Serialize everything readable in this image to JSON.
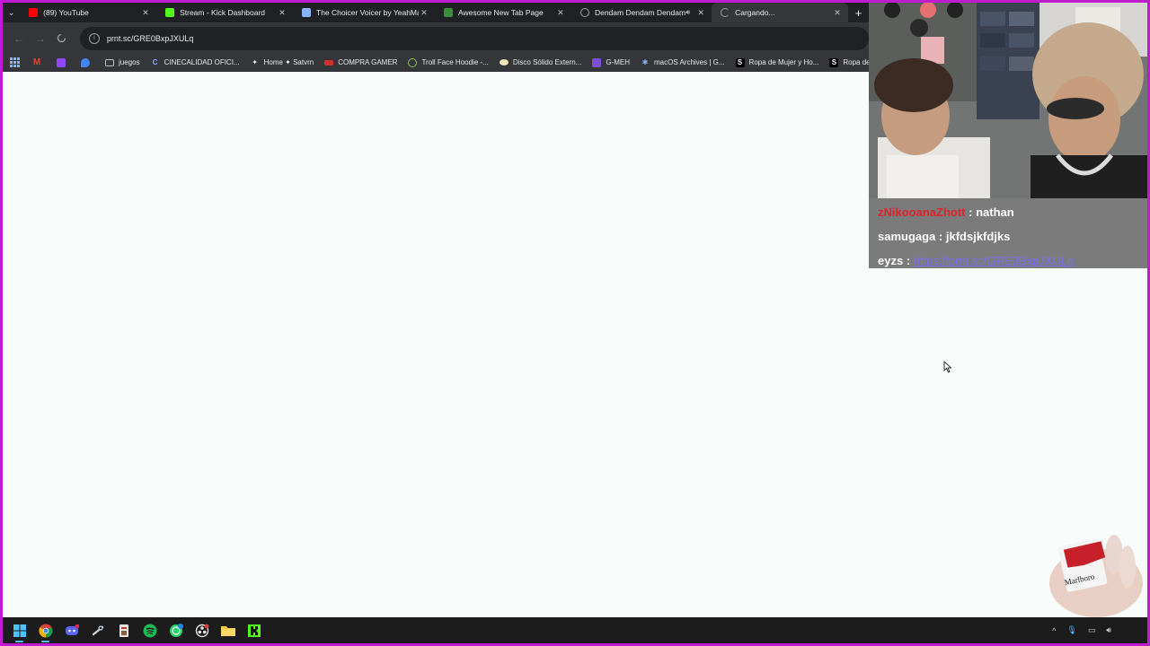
{
  "browser": {
    "tabs": [
      {
        "title": "(89) YouTube",
        "favicon_color": "#ff0000"
      },
      {
        "title": "Stream - Kick Dashboard",
        "favicon_color": "#53fc18"
      },
      {
        "title": "The Choicer Voicer by YeahMay",
        "favicon_color": "#8ab4f8"
      },
      {
        "title": "Awesome New Tab Page",
        "favicon_color": "#3c8d3c"
      },
      {
        "title": "Dendam Dendam Dendam",
        "favicon_color": "#9aa0a6"
      },
      {
        "title": "Cargando...",
        "favicon_color": "#9aa0a6"
      }
    ],
    "address": {
      "url": "prnt.sc/GRE0BxpJXULq"
    },
    "bookmarks": [
      {
        "label": "juegos",
        "icon": "folder-icon"
      },
      {
        "label": "CINECALIDAD OFICI...",
        "icon": "c-icon"
      },
      {
        "label": "Home ✦ Satvrn",
        "icon": "star-icon"
      },
      {
        "label": "COMPRA GAMER",
        "icon": "compra-icon"
      },
      {
        "label": "Troll Face Hoodie -...",
        "icon": "troll-icon"
      },
      {
        "label": "Disco Sólido Extern...",
        "icon": "disk-icon"
      },
      {
        "label": "G-MEH",
        "icon": "g-icon"
      },
      {
        "label": "macOS Archives | G...",
        "icon": "mac-icon"
      },
      {
        "label": "Ropa de Mujer y Ho...",
        "icon": "s-icon"
      },
      {
        "label": "Ropa de Mujer y H",
        "icon": "s-icon"
      }
    ]
  },
  "chat": {
    "messages": [
      {
        "user": "zNikooanaZhott",
        "sep": " : ",
        "text": "nathan"
      },
      {
        "user": "samugaga",
        "sep": " : ",
        "text": "jkfdsjkfdjks"
      },
      {
        "user": "eyzs",
        "sep": " : ",
        "text": "https://prnt.sc/GRE0BxpJXULq"
      }
    ]
  },
  "taskbar": {
    "icons": [
      "windows-start-icon",
      "chrome-icon",
      "discord-icon",
      "steam-icon",
      "app-icon",
      "spotify-icon",
      "whatsapp-icon",
      "obs-icon",
      "file-explorer-icon",
      "kick-icon"
    ]
  },
  "colors": {
    "frame": "#c01bd0",
    "chat_bg": "#7b7b7b",
    "chat_user_red": "#e0212e",
    "chat_link": "#7c6df0"
  }
}
